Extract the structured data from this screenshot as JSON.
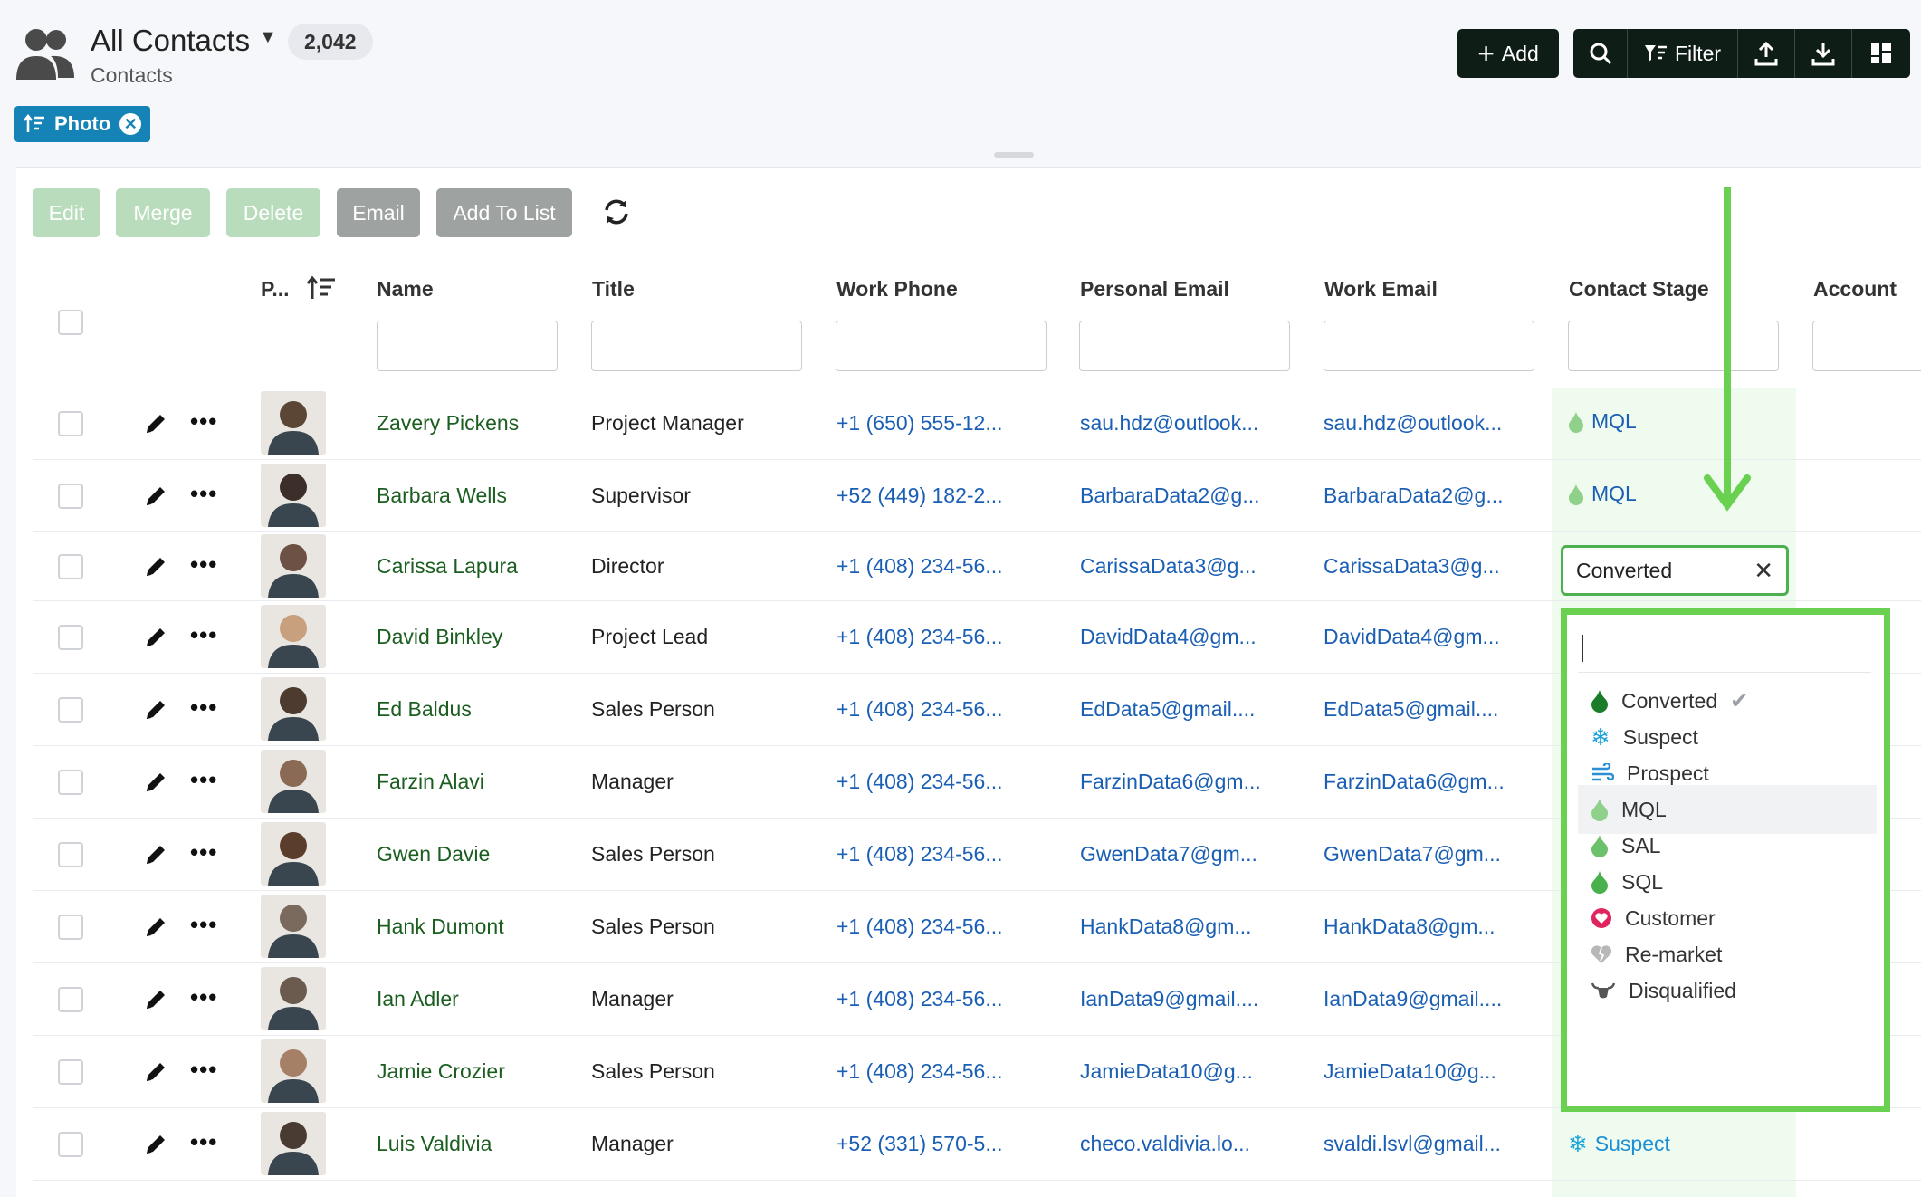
{
  "header": {
    "title": "All Contacts",
    "count": "2,042",
    "subtitle": "Contacts",
    "chip_label": "Photo",
    "add_label": "Add",
    "filter_label": "Filter"
  },
  "actions": {
    "edit": "Edit",
    "merge": "Merge",
    "delete": "Delete",
    "email": "Email",
    "add_to_list": "Add To List"
  },
  "columns": {
    "photo": "P...",
    "name": "Name",
    "title": "Title",
    "work_phone": "Work Phone",
    "personal_email": "Personal Email",
    "work_email": "Work Email",
    "contact_stage": "Contact Stage",
    "account": "Account"
  },
  "rows": [
    {
      "name": "Zavery Pickens",
      "title": "Project Manager",
      "phone": "+1 (650) 555-12...",
      "personal_email": "sau.hdz@outlook...",
      "work_email": "sau.hdz@outlook...",
      "stage": "MQL"
    },
    {
      "name": "Barbara Wells",
      "title": "Supervisor",
      "phone": "+52 (449) 182-2...",
      "personal_email": "BarbaraData2@g...",
      "work_email": "BarbaraData2@g...",
      "stage": "MQL"
    },
    {
      "name": "Carissa Lapura",
      "title": "Director",
      "phone": "+1 (408) 234-56...",
      "personal_email": "CarissaData3@g...",
      "work_email": "CarissaData3@g...",
      "stage": "Converted"
    },
    {
      "name": "David Binkley",
      "title": "Project Lead",
      "phone": "+1 (408) 234-56...",
      "personal_email": "DavidData4@gm...",
      "work_email": "DavidData4@gm...",
      "stage": ""
    },
    {
      "name": "Ed Baldus",
      "title": "Sales Person",
      "phone": "+1 (408) 234-56...",
      "personal_email": "EdData5@gmail....",
      "work_email": "EdData5@gmail....",
      "stage": ""
    },
    {
      "name": "Farzin Alavi",
      "title": "Manager",
      "phone": "+1 (408) 234-56...",
      "personal_email": "FarzinData6@gm...",
      "work_email": "FarzinData6@gm...",
      "stage": ""
    },
    {
      "name": "Gwen Davie",
      "title": "Sales Person",
      "phone": "+1 (408) 234-56...",
      "personal_email": "GwenData7@gm...",
      "work_email": "GwenData7@gm...",
      "stage": ""
    },
    {
      "name": "Hank Dumont",
      "title": "Sales Person",
      "phone": "+1 (408) 234-56...",
      "personal_email": "HankData8@gm...",
      "work_email": "HankData8@gm...",
      "stage": ""
    },
    {
      "name": "Ian Adler",
      "title": "Manager",
      "phone": "+1 (408) 234-56...",
      "personal_email": "IanData9@gmail....",
      "work_email": "IanData9@gmail....",
      "stage": ""
    },
    {
      "name": "Jamie Crozier",
      "title": "Sales Person",
      "phone": "+1 (408) 234-56...",
      "personal_email": "JamieData10@g...",
      "work_email": "JamieData10@g...",
      "stage": ""
    },
    {
      "name": "Luis Valdivia",
      "title": "Manager",
      "phone": "+52 (331) 570-5...",
      "personal_email": "checo.valdivia.lo...",
      "work_email": "svaldi.lsvl@gmail...",
      "stage": "Suspect"
    }
  ],
  "stage_editor": {
    "value": "Converted"
  },
  "stage_options": [
    {
      "label": "Converted",
      "icon": "flame-dark-icon",
      "color": "#1b7d2a",
      "selected": true
    },
    {
      "label": "Suspect",
      "icon": "snowflake-icon",
      "color": "#1aa3d9"
    },
    {
      "label": "Prospect",
      "icon": "wind-icon",
      "color": "#2b8fd6"
    },
    {
      "label": "MQL",
      "icon": "flame-light-icon",
      "color": "#8fd08a"
    },
    {
      "label": "SAL",
      "icon": "flame-mid-icon",
      "color": "#6cc26a"
    },
    {
      "label": "SQL",
      "icon": "flame-green-icon",
      "color": "#48b04c"
    },
    {
      "label": "Customer",
      "icon": "heart-icon",
      "color": "#e0245e"
    },
    {
      "label": "Re-market",
      "icon": "broken-heart-icon",
      "color": "#b8b8b8"
    },
    {
      "label": "Disqualified",
      "icon": "bull-icon",
      "color": "#555555"
    }
  ],
  "colors": {
    "accent": "#1583b6",
    "dark_button": "#0f1d17",
    "highlight_green": "#6ad04f",
    "name_green": "#1b5e20",
    "link_blue": "#1a5fb4"
  }
}
